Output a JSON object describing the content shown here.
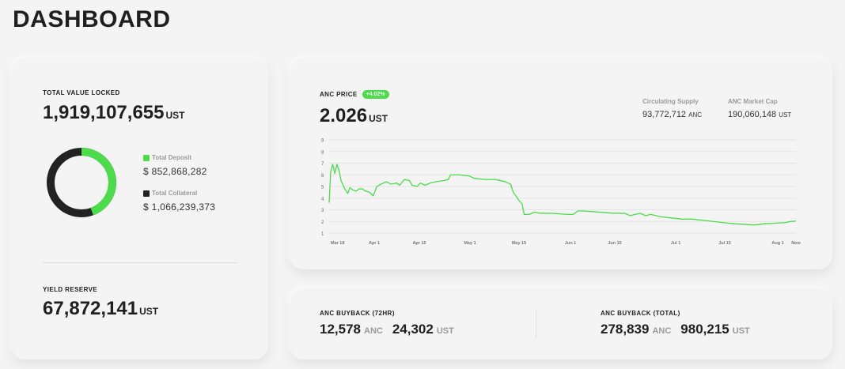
{
  "page": {
    "title": "DASHBOARD"
  },
  "tvl": {
    "label": "TOTAL VALUE LOCKED",
    "value": "1,919,107,655",
    "unit": "UST",
    "deposit": {
      "label": "Total Deposit",
      "value": "$ 852,868,282",
      "amount": 852868282,
      "color": "#4bdb4b"
    },
    "collateral": {
      "label": "Total Collateral",
      "value": "$ 1,066,239,373",
      "amount": 1066239373,
      "color": "#222222"
    }
  },
  "yield_reserve": {
    "label": "YIELD RESERVE",
    "value": "67,872,141",
    "unit": "UST"
  },
  "anc_price": {
    "label": "ANC PRICE",
    "change": "+4.02%",
    "value": "2.026",
    "unit": "UST",
    "circulating_supply": {
      "label": "Circulating Supply",
      "value": "93,772,712",
      "unit": "ANC"
    },
    "market_cap": {
      "label": "ANC Market Cap",
      "value": "190,060,148",
      "unit": "UST"
    }
  },
  "buyback": {
    "h72": {
      "label": "ANC BUYBACK (72HR)",
      "anc": "12,578",
      "anc_unit": "ANC",
      "ust": "24,302",
      "ust_unit": "UST"
    },
    "total": {
      "label": "ANC BUYBACK (TOTAL)",
      "anc": "278,839",
      "anc_unit": "ANC",
      "ust": "980,215",
      "ust_unit": "UST"
    }
  },
  "chart_data": {
    "type": "line",
    "title": "",
    "xlabel": "",
    "ylabel": "",
    "ylim": [
      1,
      9
    ],
    "yticks": [
      "1",
      "2",
      "3",
      "4",
      "5",
      "6",
      "7",
      "8",
      "9"
    ],
    "xticks": [
      "Mar 18",
      "Apr 1",
      "Apr 15",
      "May 1",
      "May 15",
      "Jun 1",
      "Jun 15",
      "Jul 1",
      "Jul 15",
      "Aug 1",
      "Now"
    ],
    "grid": true,
    "line_color": "#4bdb4b",
    "series": [
      {
        "values": [
          [
            0,
            3.6
          ],
          [
            0.3,
            6.3
          ],
          [
            0.7,
            6.9
          ],
          [
            1.1,
            6.1
          ],
          [
            1.5,
            6.9
          ],
          [
            1.9,
            6.4
          ],
          [
            2.3,
            5.5
          ],
          [
            3,
            4.8
          ],
          [
            3.6,
            4.4
          ],
          [
            4,
            4.9
          ],
          [
            4.6,
            4.7
          ],
          [
            5.2,
            4.6
          ],
          [
            5.8,
            4.8
          ],
          [
            6.4,
            4.8
          ],
          [
            7,
            4.6
          ],
          [
            7.8,
            4.5
          ],
          [
            8.5,
            4.2
          ],
          [
            9.2,
            5.0
          ],
          [
            10,
            5.2
          ],
          [
            11,
            5.4
          ],
          [
            12,
            5.2
          ],
          [
            13,
            5.3
          ],
          [
            13.6,
            5.1
          ],
          [
            14.5,
            5.6
          ],
          [
            15.5,
            5.5
          ],
          [
            16,
            5.1
          ],
          [
            17,
            5.0
          ],
          [
            17.6,
            5.3
          ],
          [
            18.5,
            5.1
          ],
          [
            19.5,
            5.3
          ],
          [
            20.5,
            5.4
          ],
          [
            22,
            5.5
          ],
          [
            23,
            5.6
          ],
          [
            23.4,
            6.0
          ],
          [
            25,
            6.0
          ],
          [
            27,
            5.9
          ],
          [
            28,
            5.7
          ],
          [
            30,
            5.6
          ],
          [
            32,
            5.6
          ],
          [
            34,
            5.4
          ],
          [
            35,
            5.2
          ],
          [
            35.5,
            4.5
          ],
          [
            36,
            4.2
          ],
          [
            36.6,
            3.8
          ],
          [
            37.2,
            3.5
          ],
          [
            37.6,
            2.6
          ],
          [
            38.6,
            2.6
          ],
          [
            39.6,
            2.8
          ],
          [
            40.6,
            2.7
          ],
          [
            43,
            2.7
          ],
          [
            46,
            2.6
          ],
          [
            47,
            2.6
          ],
          [
            48,
            2.9
          ],
          [
            49,
            2.9
          ],
          [
            52,
            2.8
          ],
          [
            55,
            2.7
          ],
          [
            57,
            2.7
          ],
          [
            58,
            2.5
          ],
          [
            59,
            2.6
          ],
          [
            60,
            2.7
          ],
          [
            61,
            2.5
          ],
          [
            62,
            2.6
          ],
          [
            64,
            2.4
          ],
          [
            66,
            2.3
          ],
          [
            68,
            2.2
          ],
          [
            70,
            2.2
          ],
          [
            72,
            2.1
          ],
          [
            74,
            2.0
          ],
          [
            76,
            1.9
          ],
          [
            78,
            1.8
          ],
          [
            80,
            1.75
          ],
          [
            82,
            1.7
          ],
          [
            84,
            1.8
          ],
          [
            86,
            1.85
          ],
          [
            88,
            1.9
          ],
          [
            89,
            2.0
          ],
          [
            90,
            2.03
          ]
        ]
      }
    ]
  }
}
